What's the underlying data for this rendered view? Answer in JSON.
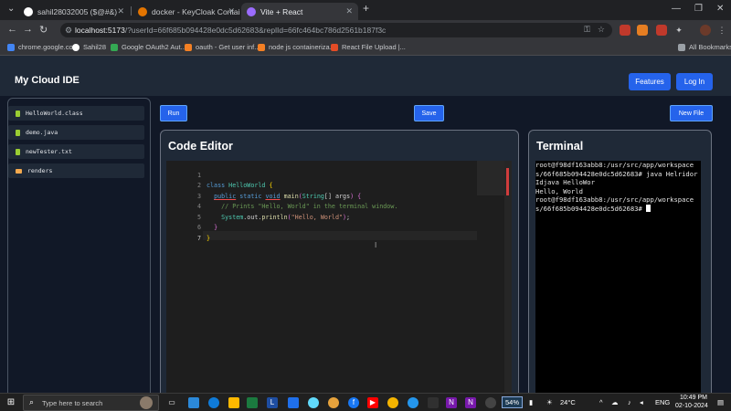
{
  "browser": {
    "tabs": [
      {
        "title": "sahil28032005 ($@#&)",
        "favicon_color": "#ffffff"
      },
      {
        "title": "docker - KeyCloak Container R...",
        "favicon_color": "#e37400"
      },
      {
        "title": "Vite + React",
        "favicon_color": "#9b6cff"
      }
    ],
    "new_tab": "+",
    "url_host": "localhost:5173",
    "url_path": "/?userId=66f685b094428e0dc5d62683&replId=66fc464bc786d2561b187f3c",
    "bookmarks": [
      {
        "label": "chrome.google.com",
        "color": "#4285f4"
      },
      {
        "label": "Sahil28",
        "color": "#ffffff"
      },
      {
        "label": "Google OAuth2 Aut...",
        "color": "#34a853"
      },
      {
        "label": "oauth - Get user inf...",
        "color": "#f48024"
      },
      {
        "label": "node js containeriza...",
        "color": "#f48024"
      },
      {
        "label": "React File Upload |...",
        "color": "#e34c26"
      }
    ],
    "all_bookmarks": "All Bookmarks"
  },
  "app": {
    "title": "My Cloud IDE",
    "features_button": "Features",
    "login_button": "Log In",
    "run_button": "Run",
    "save_button": "Save",
    "new_file_button": "New File",
    "files": [
      {
        "name": "HelloWorld.class",
        "color": "#9acd32"
      },
      {
        "name": "demo.java",
        "color": "#9acd32"
      },
      {
        "name": "newTester.txt",
        "color": "#9acd32"
      },
      {
        "name": "renders",
        "color": "#f4a94e"
      }
    ],
    "editor": {
      "title": "Code Editor",
      "line_numbers": [
        "1",
        "2",
        "3",
        "4",
        "5",
        "6",
        "7"
      ]
    },
    "terminal": {
      "title": "Terminal",
      "lines": [
        "root@f98df163abb8:/usr/src/app/workspaces/66f685b094428e0dc5d62683# java HelridorIdjava HelloWor",
        "Hello, World",
        "root@f98df163abb8:/usr/src/app/workspaces/66f685b094428e0dc5d62683# "
      ]
    }
  },
  "taskbar": {
    "search_placeholder": "Type here to search",
    "battery": "54%",
    "temperature": "24°C",
    "language": "ENG",
    "time": "10:49 PM",
    "date": "02-10-2024"
  }
}
